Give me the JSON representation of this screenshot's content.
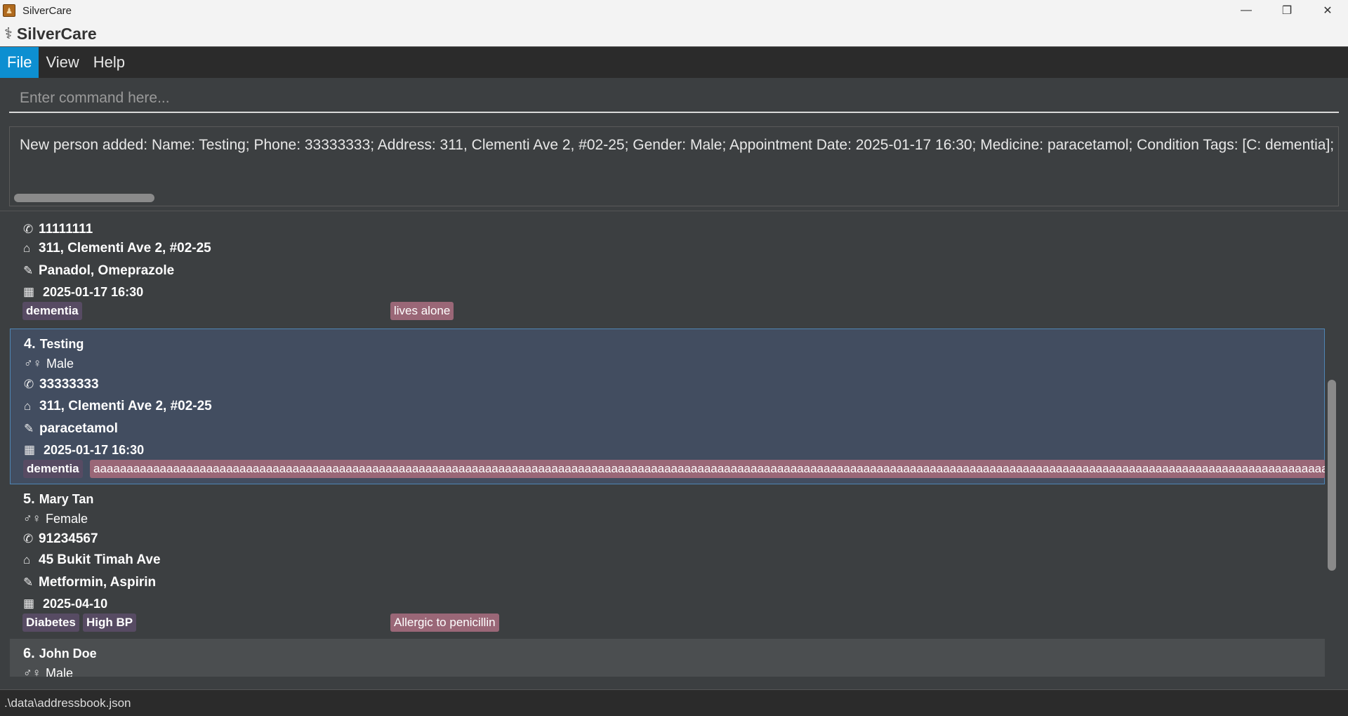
{
  "window": {
    "title": "SilverCare",
    "controls": [
      "—",
      "❐",
      "✕"
    ]
  },
  "brand": {
    "name": "SilverCare",
    "icon": "medical-icon"
  },
  "menu": {
    "items": [
      "File",
      "View",
      "Help"
    ],
    "active": "File"
  },
  "command": {
    "placeholder": "Enter command here...",
    "value": ""
  },
  "result": {
    "text": "New person added: Name: Testing; Phone: 33333333; Address: 311, Clementi Ave 2, #02-25; Gender: Male; Appointment Date: 2025-01-17 16:30; Medicine: paracetamol; Condition Tags: [C: dementia]; Detail T"
  },
  "persons": [
    {
      "index": "",
      "name": "",
      "gender": "",
      "phone": "11111111",
      "address": "311, Clementi Ave 2, #02-25",
      "medicine": "Panadol, Omeprazole",
      "appointment": "2025-01-17 16:30",
      "condition_tags": [
        "dementia"
      ],
      "detail_tags": [
        "lives alone"
      ]
    },
    {
      "index": "4.",
      "name": "Testing",
      "gender": "Male",
      "phone": "33333333",
      "address": "311, Clementi Ave 2, #02-25",
      "medicine": "paracetamol",
      "appointment": "2025-01-17 16:30",
      "condition_tags": [
        "dementia"
      ],
      "detail_tags": [
        "aaaaaaaaaaaaaaaaaaaaaaaaaaaaaaaaaaaaaaaaaaaaaaaaaaaaaaaaaaaaaaaaaaaaaaaaaaaaaaaaaaaaaaaaaaaaaaaaaaaaaaaaaaaaaaaaaaaaaaaaaaaaaaaaaaaaaaaaaaaaaaaaaaaaaaaaaaaaaaaaaaaaaaaaaaaaaaaaaaaaaaaaaaaaaaaaaaaaaaaaaaaaaaaaaaaaaaaa"
      ]
    },
    {
      "index": "5.",
      "name": "Mary Tan",
      "gender": "Female",
      "phone": "91234567",
      "address": "45 Bukit Timah Ave",
      "medicine": "Metformin, Aspirin",
      "appointment": "2025-04-10",
      "condition_tags": [
        "Diabetes",
        "High BP"
      ],
      "detail_tags": [
        "Allergic to penicillin"
      ]
    },
    {
      "index": "6.",
      "name": "John Doe",
      "gender": "Male"
    }
  ],
  "icons": {
    "gender": "♂♀",
    "phone": "✆",
    "address": "⌂",
    "medicine": "✎",
    "calendar": "▦"
  },
  "status": {
    "path": ".\\data\\addressbook.json"
  },
  "colors": {
    "accent": "#0d8fd1",
    "condition_tag": "#574b63",
    "detail_tag": "#9a6777",
    "selected_card": "#424d60"
  }
}
